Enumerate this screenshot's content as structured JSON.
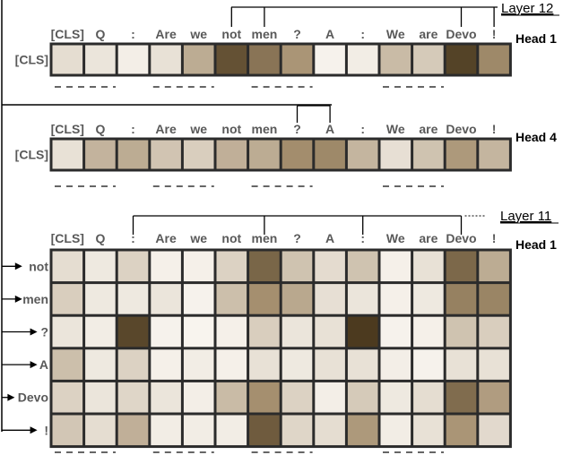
{
  "tokens": [
    "[CLS]",
    "Q",
    ":",
    "Are",
    "we",
    "not",
    "men",
    "?",
    "A",
    ":",
    "We",
    "are",
    "Devo",
    "!"
  ],
  "colors": {
    "light": "#fbf8f3",
    "dark": "#433217",
    "mid": "#a58f6f",
    "line": "#000000",
    "grid_border": "#2b2b2b",
    "token_text": "#595959"
  },
  "panels": [
    {
      "id": "layer12-head1",
      "layer_label": "Layer 12",
      "head_label": "Head 1",
      "bracket_tokens": [
        5,
        6,
        12,
        13
      ],
      "rows": [
        "[CLS]"
      ],
      "row_arrows": false,
      "values": [
        [
          0.14,
          0.1,
          0.05,
          0.12,
          0.4,
          0.85,
          0.68,
          0.52,
          0.03,
          0.06,
          0.32,
          0.24,
          0.92,
          0.58
        ]
      ]
    },
    {
      "id": "layer12-head4",
      "layer_label": "",
      "head_label": "Head 4",
      "bracket_tokens": [
        7,
        8
      ],
      "rows": [
        "[CLS]"
      ],
      "row_arrows": false,
      "values": [
        [
          0.12,
          0.36,
          0.4,
          0.27,
          0.22,
          0.38,
          0.4,
          0.56,
          0.58,
          0.35,
          0.13,
          0.28,
          0.5,
          0.35
        ]
      ]
    },
    {
      "id": "layer11-head1",
      "layer_label": "Layer 11",
      "head_label": "Head 1",
      "bracket_tokens": [
        2,
        6,
        9,
        12
      ],
      "rows": [
        "not",
        "men",
        "?",
        "A",
        "Devo",
        "!"
      ],
      "row_arrows": true,
      "values": [
        [
          0.14,
          0.08,
          0.2,
          0.04,
          0.04,
          0.2,
          0.75,
          0.28,
          0.15,
          0.28,
          0.04,
          0.12,
          0.74,
          0.4
        ],
        [
          0.22,
          0.08,
          0.08,
          0.1,
          0.03,
          0.3,
          0.55,
          0.42,
          0.13,
          0.1,
          0.04,
          0.08,
          0.62,
          0.6
        ],
        [
          0.1,
          0.06,
          0.9,
          0.03,
          0.02,
          0.04,
          0.22,
          0.1,
          0.12,
          0.96,
          0.03,
          0.04,
          0.28,
          0.22
        ],
        [
          0.3,
          0.08,
          0.2,
          0.04,
          0.06,
          0.04,
          0.12,
          0.08,
          0.12,
          0.12,
          0.05,
          0.03,
          0.12,
          0.12
        ],
        [
          0.2,
          0.1,
          0.18,
          0.1,
          0.05,
          0.32,
          0.55,
          0.2,
          0.05,
          0.24,
          0.08,
          0.14,
          0.72,
          0.48
        ],
        [
          0.26,
          0.14,
          0.38,
          0.06,
          0.06,
          0.06,
          0.8,
          0.18,
          0.14,
          0.5,
          0.06,
          0.12,
          0.52,
          0.16
        ]
      ]
    }
  ],
  "dash_groups": 4
}
